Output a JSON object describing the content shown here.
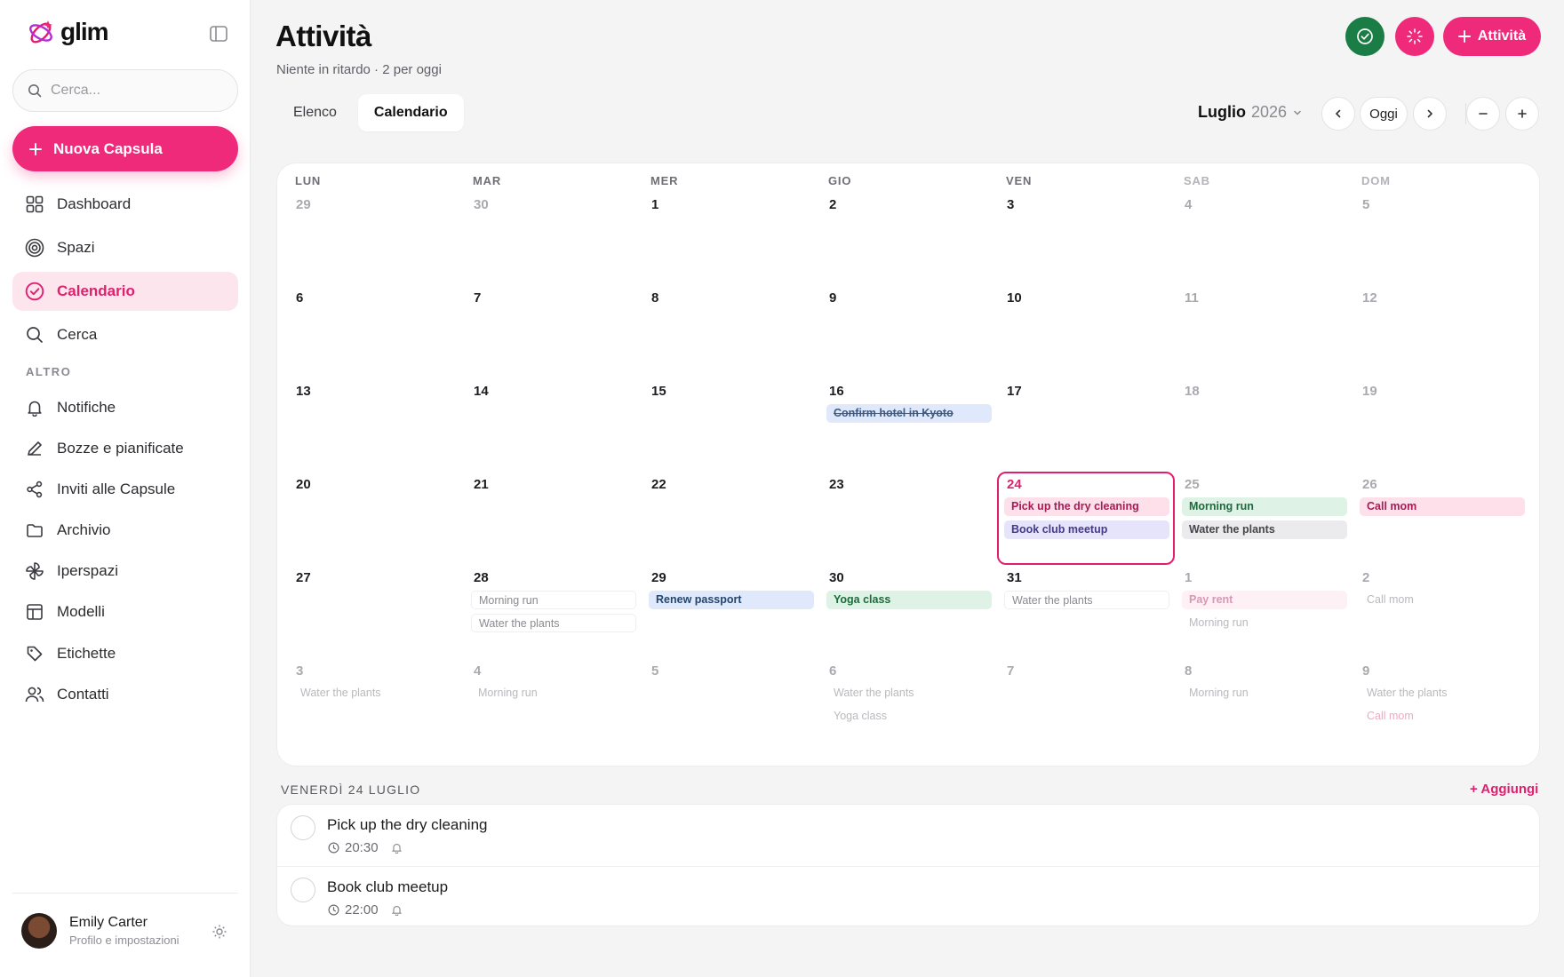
{
  "app": {
    "brand": "glim",
    "colors": {
      "accent": "#ef2a7b",
      "success": "#1a7d45",
      "sidebar_bg": "#ffffff",
      "page_bg": "#f4f4f5"
    }
  },
  "sidebar": {
    "search_placeholder": "Cerca...",
    "new_button": "Nuova Capsula",
    "items": [
      {
        "label": "Dashboard",
        "icon": "grid-icon"
      },
      {
        "label": "Spazi",
        "icon": "target-icon"
      },
      {
        "label": "Calendario",
        "icon": "check-circle-icon",
        "active": true
      },
      {
        "label": "Cerca",
        "icon": "search-icon"
      }
    ],
    "section_label": "ALTRO",
    "more_items": [
      {
        "label": "Notifiche",
        "icon": "bell-icon"
      },
      {
        "label": "Bozze e pianificate",
        "icon": "pencil-icon"
      },
      {
        "label": "Inviti alle Capsule",
        "icon": "share-icon"
      },
      {
        "label": "Archivio",
        "icon": "folder-icon"
      },
      {
        "label": "Iperspazi",
        "icon": "pinwheel-icon"
      },
      {
        "label": "Modelli",
        "icon": "layout-icon"
      },
      {
        "label": "Etichette",
        "icon": "tag-icon"
      },
      {
        "label": "Contatti",
        "icon": "users-icon"
      }
    ],
    "user": {
      "name": "Emily Carter",
      "subtitle": "Profilo e impostazioni"
    }
  },
  "header": {
    "title": "Attività",
    "subtitle": "Niente in ritardo · 2 per oggi",
    "add_button": "Attività",
    "tabs": [
      "Elenco",
      "Calendario"
    ],
    "active_tab": "Calendario",
    "month": "Luglio",
    "year": "2026",
    "today_button": "Oggi"
  },
  "calendar": {
    "weekdays": [
      "LUN",
      "MAR",
      "MER",
      "GIO",
      "VEN",
      "SAB",
      "DOM"
    ],
    "weeks": [
      [
        {
          "day": "29",
          "other": true,
          "events": []
        },
        {
          "day": "30",
          "other": true,
          "events": []
        },
        {
          "day": "1",
          "events": []
        },
        {
          "day": "2",
          "events": []
        },
        {
          "day": "3",
          "events": []
        },
        {
          "day": "4",
          "events": []
        },
        {
          "day": "5",
          "events": []
        }
      ],
      [
        {
          "day": "6",
          "events": []
        },
        {
          "day": "7",
          "events": []
        },
        {
          "day": "8",
          "events": []
        },
        {
          "day": "9",
          "events": []
        },
        {
          "day": "10",
          "events": []
        },
        {
          "day": "11",
          "events": []
        },
        {
          "day": "12",
          "events": []
        }
      ],
      [
        {
          "day": "13",
          "events": []
        },
        {
          "day": "14",
          "events": []
        },
        {
          "day": "15",
          "events": []
        },
        {
          "day": "16",
          "events": [
            {
              "label": "Confirm hotel in Kyoto",
              "style": "blue done"
            }
          ]
        },
        {
          "day": "17",
          "events": []
        },
        {
          "day": "18",
          "events": []
        },
        {
          "day": "19",
          "events": []
        }
      ],
      [
        {
          "day": "20",
          "events": []
        },
        {
          "day": "21",
          "events": []
        },
        {
          "day": "22",
          "events": []
        },
        {
          "day": "23",
          "events": []
        },
        {
          "day": "24",
          "today": true,
          "events": [
            {
              "label": "Pick up the dry cleaning",
              "style": "pink"
            },
            {
              "label": "Book club meetup",
              "style": "purple"
            }
          ]
        },
        {
          "day": "25",
          "events": [
            {
              "label": "Morning run",
              "style": "green"
            },
            {
              "label": "Water the plants",
              "style": "gray"
            }
          ]
        },
        {
          "day": "26",
          "events": [
            {
              "label": "Call mom",
              "style": "pink"
            }
          ]
        }
      ],
      [
        {
          "day": "27",
          "events": []
        },
        {
          "day": "28",
          "events": [
            {
              "label": "Morning run",
              "style": "outline"
            },
            {
              "label": "Water the plants",
              "style": "outline"
            }
          ]
        },
        {
          "day": "29",
          "events": [
            {
              "label": "Renew passport",
              "style": "blue"
            }
          ]
        },
        {
          "day": "30",
          "events": [
            {
              "label": "Yoga class",
              "style": "green"
            }
          ]
        },
        {
          "day": "31",
          "events": [
            {
              "label": "Water the plants",
              "style": "outline"
            }
          ]
        },
        {
          "day": "1",
          "other": true,
          "events": [
            {
              "label": "Pay rent",
              "style": "pink faded"
            },
            {
              "label": "Morning run",
              "style": "ghost"
            }
          ]
        },
        {
          "day": "2",
          "other": true,
          "events": [
            {
              "label": "Call mom",
              "style": "ghost"
            }
          ]
        }
      ],
      [
        {
          "day": "3",
          "other": true,
          "events": [
            {
              "label": "Water the plants",
              "style": "ghost"
            }
          ]
        },
        {
          "day": "4",
          "other": true,
          "events": [
            {
              "label": "Morning run",
              "style": "ghost"
            }
          ]
        },
        {
          "day": "5",
          "other": true,
          "events": []
        },
        {
          "day": "6",
          "other": true,
          "events": [
            {
              "label": "Water the plants",
              "style": "ghost"
            },
            {
              "label": "Yoga class",
              "style": "ghost"
            }
          ]
        },
        {
          "day": "7",
          "other": true,
          "events": []
        },
        {
          "day": "8",
          "other": true,
          "events": [
            {
              "label": "Morning run",
              "style": "ghost"
            }
          ]
        },
        {
          "day": "9",
          "other": true,
          "events": [
            {
              "label": "Water the plants",
              "style": "ghost"
            },
            {
              "label": "Call mom",
              "style": "ghost-pink"
            }
          ]
        }
      ]
    ]
  },
  "day_panel": {
    "title": "VENERDÌ 24 LUGLIO",
    "add_label": "+ Aggiungi",
    "tasks": [
      {
        "name": "Pick up the dry cleaning",
        "time": "20:30"
      },
      {
        "name": "Book club meetup",
        "time": "22:00"
      }
    ]
  }
}
